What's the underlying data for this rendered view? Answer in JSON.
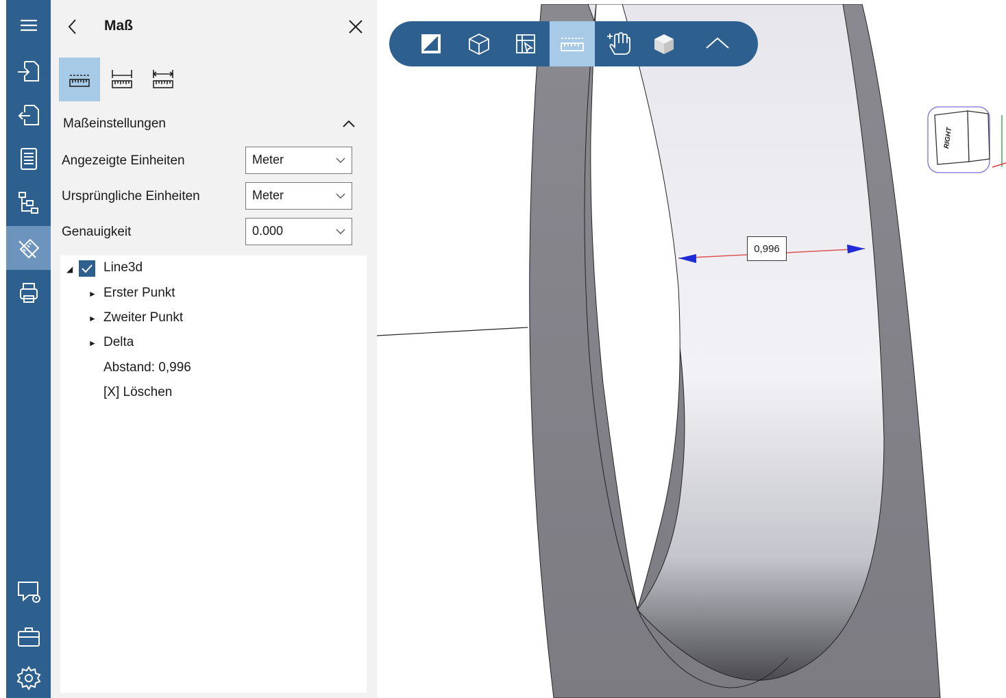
{
  "panel": {
    "title": "Maß",
    "section_title": "Maßeinstellungen",
    "settings": [
      {
        "label": "Angezeigte Einheiten",
        "value": "Meter"
      },
      {
        "label": "Ursprüngliche Einheiten",
        "value": "Meter"
      },
      {
        "label": "Genauigkeit",
        "value": "0.000"
      }
    ],
    "tree": {
      "root": "Line3d",
      "children": [
        "Erster Punkt",
        "Zweiter Punkt",
        "Delta"
      ],
      "distance": "Abstand: 0,996",
      "delete": "[X] Löschen"
    }
  },
  "viewport": {
    "dimension_label": "0,996",
    "viewcube_label": "RIGHT"
  },
  "colors": {
    "rail": "#2d5f8f",
    "rail_active": "#6d94bd",
    "tool_active": "#a7cbe6",
    "panel_bg": "#f2f2f2",
    "model": "#7d7c82"
  },
  "icons": {
    "rail": [
      "open-file-icon",
      "export-file-icon",
      "document-icon",
      "model-tree-icon",
      "measure-tool-icon",
      "print-icon",
      "feedback-icon",
      "briefcase-icon",
      "settings-gear-icon"
    ],
    "toolbar": [
      "section-plane-icon",
      "wireframe-cube-icon",
      "select-box-icon",
      "ruler-icon",
      "pan-hand-icon",
      "solid-cube-icon",
      "collapse-chevron-icon"
    ],
    "panel_tools": [
      "point-measure-icon",
      "line-measure-icon",
      "distance-measure-icon"
    ]
  }
}
